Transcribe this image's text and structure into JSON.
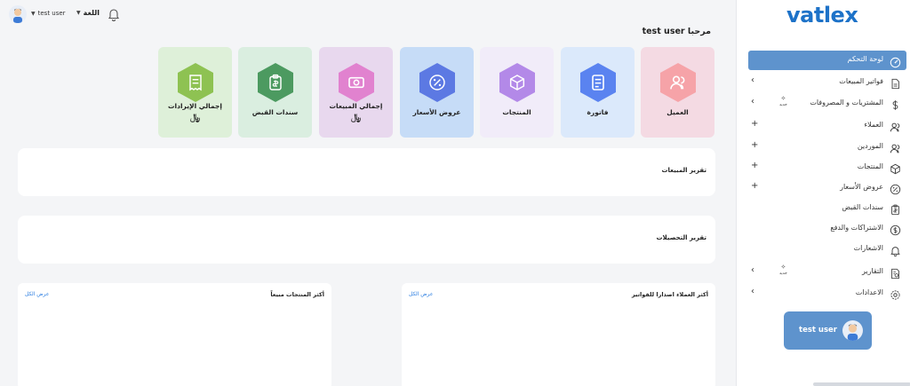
{
  "topbar": {
    "user_name": "test user",
    "language_label": "اللغة",
    "user_icon": "avatar-icon",
    "bell_icon": "bell-icon"
  },
  "greeting": "مرحبا test user",
  "cards": [
    {
      "label": "العميل",
      "icon": "users-icon",
      "bg": "#f4dae3",
      "hex": "#f6a3a8"
    },
    {
      "label": "فاتورة",
      "icon": "invoice-icon",
      "bg": "#dbe9fb",
      "hex": "#5a83f0"
    },
    {
      "label": "المنتجات",
      "icon": "box-icon",
      "bg": "#f1ecf9",
      "hex": "#b389e8"
    },
    {
      "label": "عروض الأسعار",
      "icon": "percent-icon",
      "bg": "#c6dcf7",
      "hex": "#5c79e3"
    },
    {
      "label": "إجمالي المبيعات",
      "currency": "﷼",
      "icon": "money-icon",
      "bg": "#e8d8ee",
      "hex": "#e182cf"
    },
    {
      "label": "سندات القبض",
      "icon": "clipboard-icon",
      "bg": "#daeee0",
      "hex": "#4c9a60"
    },
    {
      "label": "إجمالي الإيرادات",
      "currency": "﷼",
      "icon": "receipt-icon",
      "bg": "#def0d9",
      "hex": "#8ec252"
    }
  ],
  "panels": {
    "sales_report": "تقرير المبيعات",
    "collections_report": "تقرير التحصيلات"
  },
  "boxes": {
    "top_customers": "أكثر العملاء اصدارا للفواتير",
    "top_products": "أكثر المنتجات مبيعاً",
    "view_all": "عرض الكل"
  },
  "sidebar": {
    "logo": "vatlex",
    "items": [
      {
        "label": "لوحة التحكم",
        "icon": "dashboard-icon",
        "left": "",
        "active": true
      },
      {
        "label": "فواتير المبيعات",
        "icon": "file-icon",
        "left": "‹"
      },
      {
        "label": "المشتريات و المصروفات",
        "icon": "dollar-icon",
        "left": "‹",
        "spark": true
      },
      {
        "label": "العملاء",
        "icon": "users-icon",
        "left": "+"
      },
      {
        "label": "الموردين",
        "icon": "users-icon",
        "left": "+"
      },
      {
        "label": "المنتجات",
        "icon": "box-icon",
        "left": "+"
      },
      {
        "label": "عروض الأسعار",
        "icon": "percent-icon",
        "left": "+"
      },
      {
        "label": "سندات القبض",
        "icon": "clipboard-icon",
        "left": ""
      },
      {
        "label": "الاشتراكات والدفع",
        "icon": "coin-icon",
        "left": ""
      },
      {
        "label": "الاشعارات",
        "icon": "bell-icon",
        "left": ""
      },
      {
        "label": "التقارير",
        "icon": "report-icon",
        "left": "‹",
        "spark": true
      },
      {
        "label": "الاعدادات",
        "icon": "gear-icon",
        "left": "‹"
      }
    ],
    "spark_label": "جديد",
    "user_button": "test user"
  }
}
